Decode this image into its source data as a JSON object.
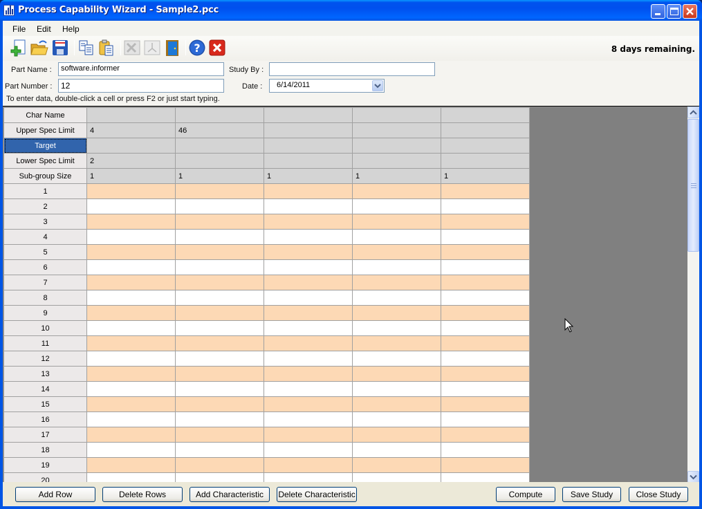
{
  "window": {
    "title": "Process Capability Wizard - Sample2.pcc",
    "controls": {
      "minimize": "minimize-icon",
      "maximize": "maximize-icon",
      "close": "close-icon"
    }
  },
  "menu": {
    "items": [
      {
        "label": "File"
      },
      {
        "label": "Edit"
      },
      {
        "label": "Help"
      }
    ]
  },
  "toolbar": {
    "buttons": [
      {
        "name": "new",
        "icon": "new-document-icon",
        "enabled": true
      },
      {
        "name": "open",
        "icon": "open-folder-icon",
        "enabled": true
      },
      {
        "name": "save",
        "icon": "save-disk-icon",
        "enabled": true
      },
      {
        "name": "copy",
        "icon": "copy-icon",
        "enabled": true
      },
      {
        "name": "paste",
        "icon": "paste-icon",
        "enabled": true
      },
      {
        "name": "export-excel",
        "icon": "excel-icon",
        "enabled": false
      },
      {
        "name": "export-pdf",
        "icon": "pdf-icon",
        "enabled": false
      },
      {
        "name": "exit",
        "icon": "door-exit-icon",
        "enabled": true
      },
      {
        "name": "help",
        "icon": "help-icon",
        "enabled": true
      },
      {
        "name": "close",
        "icon": "red-x-icon",
        "enabled": true
      }
    ],
    "trial_status": "8 days remaining."
  },
  "form": {
    "part_name_label": "Part Name :",
    "part_name_value": "software.informer",
    "study_by_label": "Study By :",
    "study_by_value": "",
    "part_number_label": "Part Number :",
    "part_number_value": "12",
    "date_label": "Date :",
    "date_value": "6/14/2011",
    "hint": "To enter data, double-click a cell or press F2 or just start typing."
  },
  "grid": {
    "spec_rows": [
      {
        "header": "Char Name",
        "cells": [
          "",
          "",
          "",
          "",
          ""
        ],
        "selected": false
      },
      {
        "header": "Upper Spec Limit",
        "cells": [
          "4",
          "46",
          "",
          "",
          ""
        ],
        "selected": false
      },
      {
        "header": "Target",
        "cells": [
          "",
          "",
          "",
          "",
          ""
        ],
        "selected": true
      },
      {
        "header": "Lower Spec Limit",
        "cells": [
          "2",
          "",
          "",
          "",
          ""
        ],
        "selected": false
      },
      {
        "header": "Sub-group Size",
        "cells": [
          "1",
          "1",
          "1",
          "1",
          "1"
        ],
        "selected": false
      }
    ],
    "data_rows": [
      "1",
      "2",
      "3",
      "4",
      "5",
      "6",
      "7",
      "8",
      "9",
      "10",
      "11",
      "12",
      "13",
      "14",
      "15",
      "16",
      "17",
      "18",
      "19",
      "20"
    ],
    "colors": {
      "odd_row": "#fdd9b5",
      "even_row": "#ffffff",
      "spec_row": "#d4d4d4",
      "selected_header": "#3164ac",
      "empty_area": "#808080"
    }
  },
  "buttons": {
    "add_row": "Add Row",
    "delete_rows": "Delete Rows",
    "add_characteristic": "Add Characteristic",
    "delete_characteristic": "Delete Characteristic",
    "compute": "Compute",
    "save_study": "Save Study",
    "close_study": "Close Study"
  }
}
